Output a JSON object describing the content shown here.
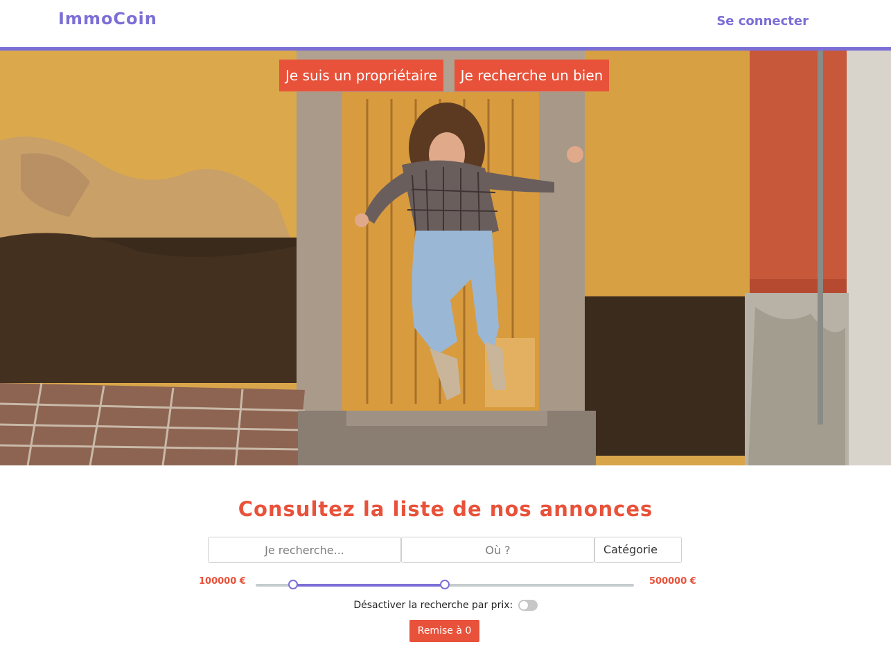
{
  "header": {
    "logo": "ImmoCoin",
    "login_label": "Se connecter"
  },
  "hero": {
    "owner_button": "Je suis un propriétaire",
    "search_button": "Je recherche un bien"
  },
  "listings": {
    "title": "Consultez la liste de nos annonces",
    "search_placeholder": "Je recherche...",
    "location_placeholder": "Où ?",
    "category_label": "Catégorie",
    "price_min": "100000 €",
    "price_max": "500000 €",
    "price_toggle_label": "Désactiver la recherche par prix:",
    "reset_label": "Remise à 0"
  },
  "colors": {
    "brand": "#7b6fd6",
    "accent": "#e8523a"
  }
}
